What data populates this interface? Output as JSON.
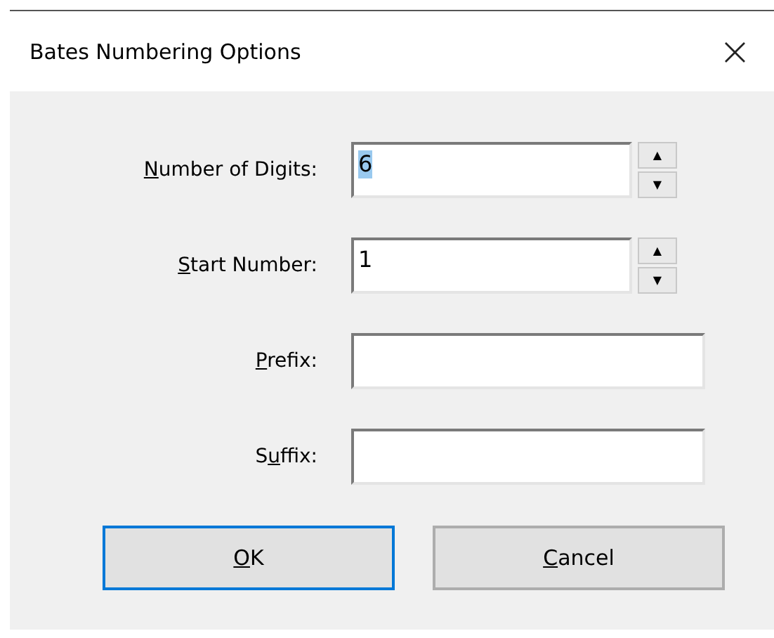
{
  "window": {
    "title": "Bates Numbering Options",
    "close": "×"
  },
  "fields": [
    {
      "kind": "spinner",
      "label": {
        "key": "N",
        "after": "umber of Digits:"
      },
      "value": "6",
      "value_selected": true,
      "up": "▲",
      "down": "▼"
    },
    {
      "kind": "spinner",
      "label": {
        "key": "S",
        "after": "tart Number:"
      },
      "value": "1",
      "value_selected": false,
      "up": "▲",
      "down": "▼"
    },
    {
      "kind": "text",
      "label": {
        "key": "P",
        "after": "refix:"
      }
    },
    {
      "kind": "text",
      "label": {
        "before": "S",
        "key": "u",
        "after": "ffix:"
      }
    }
  ],
  "buttons": [
    {
      "label": {
        "key": "O",
        "after": "K"
      },
      "default": true
    },
    {
      "label": {
        "key": "C",
        "after": "ancel"
      },
      "default": false
    }
  ]
}
